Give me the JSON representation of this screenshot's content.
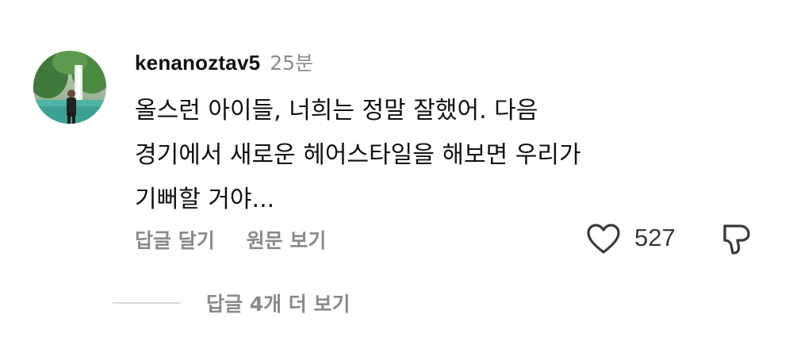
{
  "comment": {
    "username": "kenanoztav5",
    "timestamp": "25분",
    "text_lines": [
      "올스런 아이들, 너희는 정말 잘했어. 다음",
      "경기에서 새로운 헤어스타일을 해보면 우리가",
      "기뻐할 거야..."
    ],
    "actions": {
      "reply": "답글 달기",
      "see_original": "원문 보기"
    },
    "like_count": "527",
    "like_icon": "heart-outline-icon",
    "dislike_icon": "thumbs-down-outline-icon",
    "view_replies": "답글 4개 더 보기"
  },
  "colors": {
    "text": "#111111",
    "secondary": "#8a8a8a",
    "divider": "#dbdbdb",
    "icon": "#3a3a3a"
  }
}
